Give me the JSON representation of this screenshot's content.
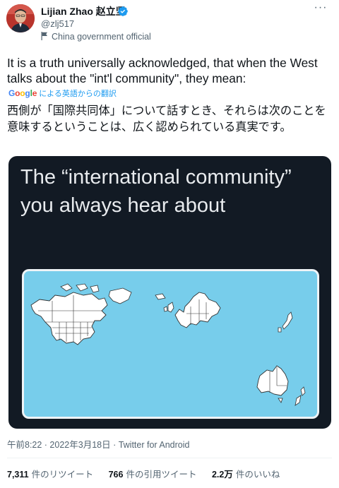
{
  "author": {
    "display_name": "Lijian Zhao 赵立坚",
    "handle": "@zlj517",
    "label": "China government official",
    "verified": true
  },
  "tweet": {
    "text_en": "It is a truth universally acknowledged, that when the West talks about the \"int'l community\", they mean:",
    "translation_brand": "Google",
    "translation_note": "による英語からの翻訳",
    "text_ja": "西側が「国際共同体」について話すとき、それらは次のことを意味するということは、広く認められている真実です。",
    "image_caption": "The “international community” you always hear about",
    "timestamp": "午前8:22 · 2022年3月18日 · Twitter for Android"
  },
  "stats": [
    {
      "count": "7,311",
      "label": "件のリツイート"
    },
    {
      "count": "766",
      "label": "件の引用ツイート"
    },
    {
      "count": "2.2万",
      "label": "件のいいね"
    }
  ],
  "icons": {
    "verified": "verified-badge-icon",
    "label": "flag-icon",
    "more": "more-dots-icon"
  },
  "colors": {
    "accent": "#1d9bf0",
    "map_ocean": "#77cdeb",
    "media_bg": "#121a24"
  }
}
